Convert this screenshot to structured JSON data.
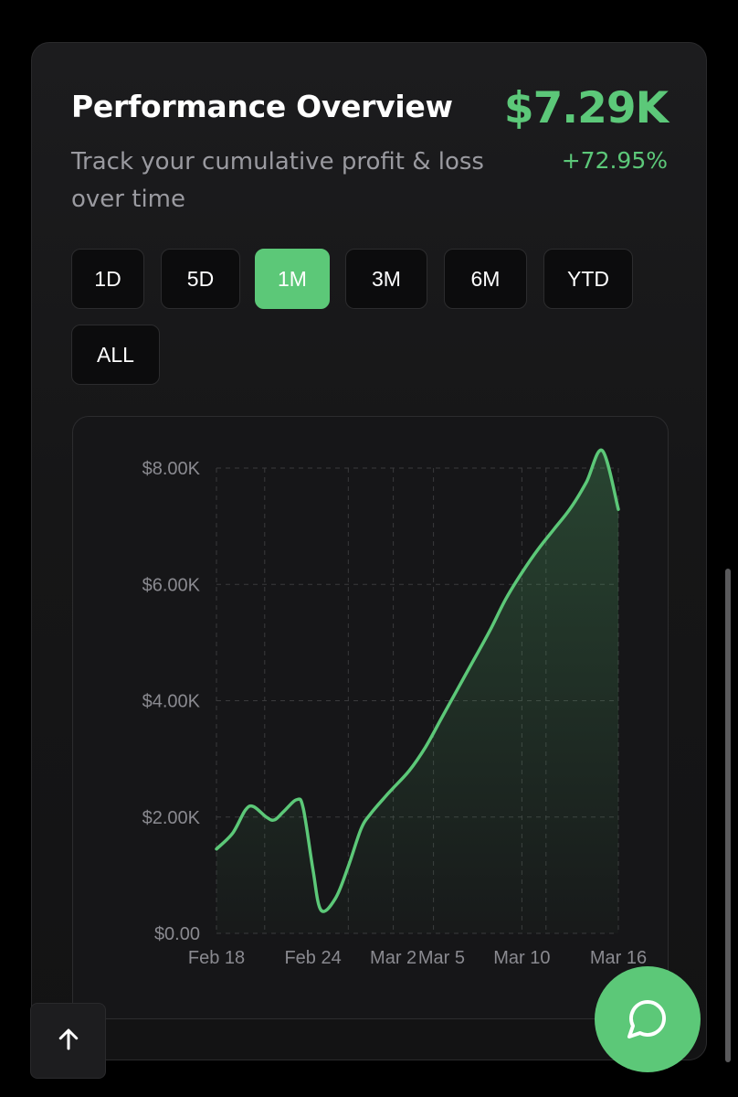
{
  "header": {
    "title": "Performance Overview",
    "subtitle": "Track your cumulative profit & loss over time",
    "value": "$7.29K",
    "change": "+72.95%"
  },
  "ranges": [
    {
      "label": "1D",
      "active": false
    },
    {
      "label": "5D",
      "active": false
    },
    {
      "label": "1M",
      "active": true
    },
    {
      "label": "3M",
      "active": false
    },
    {
      "label": "6M",
      "active": false
    },
    {
      "label": "YTD",
      "active": false
    },
    {
      "label": "ALL",
      "active": false
    }
  ],
  "colors": {
    "accent": "#5cc878",
    "background": "#000000",
    "card": "#1a1a1c",
    "grid": "#3a3a3c",
    "axis_text": "#8a8a90"
  },
  "icons": {
    "chat": "chat-bubble-icon",
    "scroll_top": "arrow-up-icon"
  },
  "chart_data": {
    "type": "area",
    "ylim": [
      0,
      8000
    ],
    "yticks": [
      0,
      2000,
      4000,
      6000,
      8000
    ],
    "ytick_labels": [
      "$0.00",
      "$2.00K",
      "$4.00K",
      "$6.00K",
      "$8.00K"
    ],
    "xticks": [
      {
        "label": "Feb 18",
        "day": 0
      },
      {
        "label": "Feb 24",
        "day": 6
      },
      {
        "label": "Mar 2",
        "day": 11
      },
      {
        "label": "Mar 5",
        "day": 14
      },
      {
        "label": "Mar 10",
        "day": 19
      },
      {
        "label": "Mar 16",
        "day": 25
      }
    ],
    "grid": true,
    "series": [
      {
        "points": [
          [
            0,
            1450
          ],
          [
            1,
            1720
          ],
          [
            1.8,
            2120
          ],
          [
            2.3,
            2180
          ],
          [
            3.1,
            2000
          ],
          [
            3.6,
            1950
          ],
          [
            4.2,
            2100
          ],
          [
            5.0,
            2300
          ],
          [
            5.4,
            2150
          ],
          [
            6.0,
            1100
          ],
          [
            6.5,
            400
          ],
          [
            7.4,
            600
          ],
          [
            8.2,
            1150
          ],
          [
            9.0,
            1800
          ],
          [
            9.6,
            2060
          ],
          [
            10.5,
            2350
          ],
          [
            11.0,
            2500
          ],
          [
            12.0,
            2800
          ],
          [
            13.0,
            3200
          ],
          [
            14.0,
            3700
          ],
          [
            15.0,
            4200
          ],
          [
            16.0,
            4700
          ],
          [
            17.0,
            5200
          ],
          [
            18.0,
            5750
          ],
          [
            19.0,
            6200
          ],
          [
            20.0,
            6600
          ],
          [
            21.0,
            6950
          ],
          [
            22.0,
            7300
          ],
          [
            23.0,
            7750
          ],
          [
            24.0,
            8300
          ],
          [
            25.0,
            7290
          ]
        ]
      }
    ]
  }
}
